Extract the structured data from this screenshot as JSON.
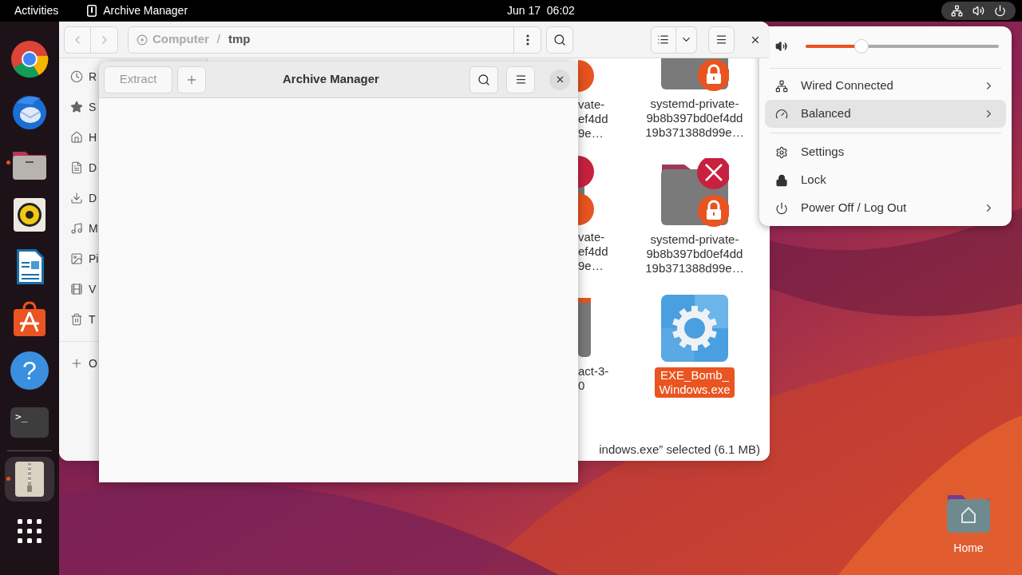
{
  "top_bar": {
    "activities": "Activities",
    "app_name": "Archive Manager",
    "clock": "Jun 17  06:02",
    "status_menu_open": true
  },
  "dock": [
    {
      "kind": "chrome",
      "running": false,
      "selected": false
    },
    {
      "kind": "mail",
      "running": false,
      "selected": false
    },
    {
      "kind": "files",
      "running": true,
      "selected": false
    },
    {
      "kind": "music",
      "running": false,
      "selected": false
    },
    {
      "kind": "writer",
      "running": false,
      "selected": false
    },
    {
      "kind": "store",
      "running": false,
      "selected": false
    },
    {
      "kind": "help",
      "glyph": "?",
      "running": false,
      "selected": false
    },
    {
      "kind": "terminal",
      "glyph": ">_",
      "running": false,
      "selected": false
    },
    {
      "kind": "archive",
      "running": true,
      "selected": true
    },
    {
      "kind": "apps",
      "running": false,
      "selected": false
    }
  ],
  "files_window": {
    "path": [
      {
        "label": "Computer"
      },
      {
        "label": "tmp"
      }
    ],
    "path_separator": "/",
    "sidebar": [
      {
        "kind": "recent",
        "label": "R"
      },
      {
        "kind": "starred",
        "label": "S"
      },
      {
        "kind": "home",
        "label": "H"
      },
      {
        "kind": "documents",
        "label": "D"
      },
      {
        "kind": "downloads",
        "label": "D"
      },
      {
        "kind": "music",
        "label": "M"
      },
      {
        "kind": "pictures",
        "label": "Pi"
      },
      {
        "kind": "videos",
        "label": "V"
      },
      {
        "kind": "trash",
        "label": "T"
      },
      {
        "kind": "other",
        "label": "O"
      }
    ],
    "partial_items": [
      {
        "lines": [
          "vate-",
          "ef4dd",
          "9e…"
        ]
      },
      {
        "lines": [
          "vate-",
          "ef4dd",
          "9e…"
        ]
      },
      {
        "lines": [
          "act-3-",
          "0"
        ]
      }
    ],
    "items": [
      {
        "kind": "folder",
        "locked": true,
        "lines": [
          "systemd-private-",
          "9b8b397bd0ef4dd",
          "19b371388d99e…"
        ],
        "selected": false
      },
      {
        "kind": "folder",
        "locked": true,
        "error": true,
        "lines": [
          "systemd-private-",
          "9b8b397bd0ef4dd",
          "19b371388d99e…"
        ],
        "selected": false
      },
      {
        "kind": "executable",
        "lines": [
          "EXE_Bomb_",
          "Windows.exe"
        ],
        "selected": true
      }
    ],
    "status": "indows.exe” selected (6.1 MB)"
  },
  "archive_window": {
    "title": "Archive Manager",
    "extract": {
      "label": "Extract",
      "disabled": true
    }
  },
  "system_menu": {
    "volume": {
      "level": 0.29
    },
    "items": [
      {
        "kind": "network",
        "label": "Wired Connected",
        "submenu": true,
        "selected": false
      },
      {
        "kind": "power_mode",
        "label": "Balanced",
        "submenu": true,
        "selected": true
      },
      {
        "kind": "settings",
        "label": "Settings",
        "submenu": false,
        "selected": false
      },
      {
        "kind": "lock",
        "label": "Lock",
        "submenu": false,
        "selected": false
      },
      {
        "kind": "power",
        "label": "Power Off / Log Out",
        "submenu": true,
        "selected": false
      }
    ]
  },
  "desktop_icons": [
    {
      "label": "Home"
    }
  ]
}
